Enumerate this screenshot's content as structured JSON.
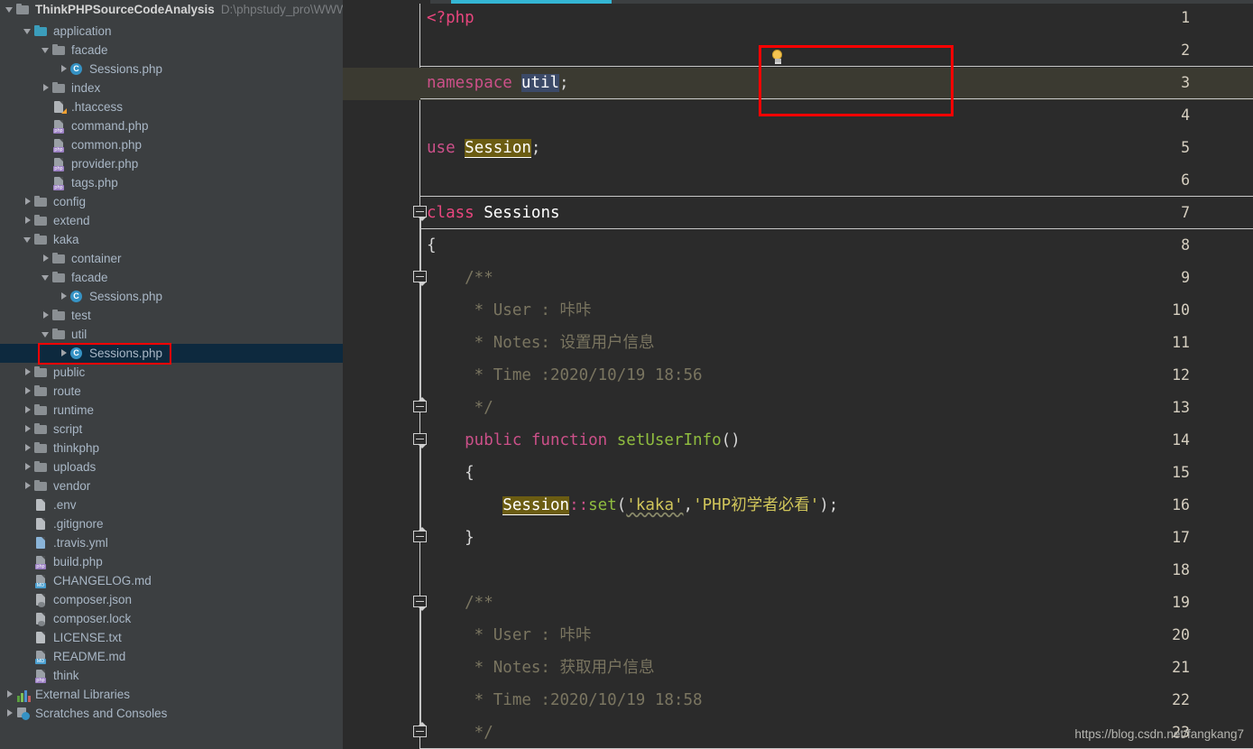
{
  "window": {
    "theme": "darcula",
    "accent_color": "#34b6d4",
    "annotation_color": "#ff0000",
    "selection_row_color": "#0d293e",
    "current_line_color": "#3b3a31"
  },
  "project_tree": {
    "root": {
      "label": "ThinkPHPSourceCodeAnalysis",
      "path": "D:\\phpstudy_pro\\WWW\\Th",
      "icon": "folder-icon",
      "expanded": true
    },
    "items": [
      {
        "label": "application",
        "icon": "folder-icon-blue",
        "indent": 1,
        "arrow": "open",
        "type": "folder"
      },
      {
        "label": "facade",
        "icon": "folder-icon",
        "indent": 2,
        "arrow": "open",
        "type": "folder"
      },
      {
        "label": "Sessions.php",
        "icon": "php-class-icon",
        "indent": 3,
        "arrow": "closed",
        "type": "class"
      },
      {
        "label": "index",
        "icon": "folder-icon",
        "indent": 2,
        "arrow": "closed",
        "type": "folder"
      },
      {
        "label": ".htaccess",
        "icon": "htaccess-file-icon",
        "indent": 2,
        "arrow": "none",
        "type": "file"
      },
      {
        "label": "command.php",
        "icon": "php-file-icon",
        "indent": 2,
        "arrow": "none",
        "type": "file"
      },
      {
        "label": "common.php",
        "icon": "php-file-icon",
        "indent": 2,
        "arrow": "none",
        "type": "file"
      },
      {
        "label": "provider.php",
        "icon": "php-file-icon",
        "indent": 2,
        "arrow": "none",
        "type": "file"
      },
      {
        "label": "tags.php",
        "icon": "php-file-icon",
        "indent": 2,
        "arrow": "none",
        "type": "file"
      },
      {
        "label": "config",
        "icon": "folder-icon",
        "indent": 1,
        "arrow": "closed",
        "type": "folder"
      },
      {
        "label": "extend",
        "icon": "folder-icon",
        "indent": 1,
        "arrow": "closed",
        "type": "folder"
      },
      {
        "label": "kaka",
        "icon": "folder-icon",
        "indent": 1,
        "arrow": "open",
        "type": "folder"
      },
      {
        "label": "container",
        "icon": "folder-icon",
        "indent": 2,
        "arrow": "closed",
        "type": "folder"
      },
      {
        "label": "facade",
        "icon": "folder-icon",
        "indent": 2,
        "arrow": "open",
        "type": "folder"
      },
      {
        "label": "Sessions.php",
        "icon": "php-class-icon",
        "indent": 3,
        "arrow": "closed",
        "type": "class"
      },
      {
        "label": "test",
        "icon": "folder-icon",
        "indent": 2,
        "arrow": "closed",
        "type": "folder"
      },
      {
        "label": "util",
        "icon": "folder-icon",
        "indent": 2,
        "arrow": "open",
        "type": "folder"
      },
      {
        "label": "Sessions.php",
        "icon": "php-class-icon",
        "indent": 3,
        "arrow": "closed",
        "type": "class",
        "selected": true,
        "annotated": true
      },
      {
        "label": "public",
        "icon": "folder-icon",
        "indent": 1,
        "arrow": "closed",
        "type": "folder"
      },
      {
        "label": "route",
        "icon": "folder-icon",
        "indent": 1,
        "arrow": "closed",
        "type": "folder"
      },
      {
        "label": "runtime",
        "icon": "folder-icon",
        "indent": 1,
        "arrow": "closed",
        "type": "folder"
      },
      {
        "label": "script",
        "icon": "folder-icon",
        "indent": 1,
        "arrow": "closed",
        "type": "folder"
      },
      {
        "label": "thinkphp",
        "icon": "folder-icon",
        "indent": 1,
        "arrow": "closed",
        "type": "folder"
      },
      {
        "label": "uploads",
        "icon": "folder-icon",
        "indent": 1,
        "arrow": "closed",
        "type": "folder"
      },
      {
        "label": "vendor",
        "icon": "folder-icon",
        "indent": 1,
        "arrow": "closed",
        "type": "folder"
      },
      {
        "label": ".env",
        "icon": "text-file-icon",
        "indent": 1,
        "arrow": "none",
        "type": "file"
      },
      {
        "label": ".gitignore",
        "icon": "text-file-icon",
        "indent": 1,
        "arrow": "none",
        "type": "file"
      },
      {
        "label": ".travis.yml",
        "icon": "yaml-file-icon",
        "indent": 1,
        "arrow": "none",
        "type": "file"
      },
      {
        "label": "build.php",
        "icon": "php-file-icon",
        "indent": 1,
        "arrow": "none",
        "type": "file"
      },
      {
        "label": "CHANGELOG.md",
        "icon": "markdown-file-icon",
        "indent": 1,
        "arrow": "none",
        "type": "file"
      },
      {
        "label": "composer.json",
        "icon": "composer-file-icon",
        "indent": 1,
        "arrow": "none",
        "type": "file"
      },
      {
        "label": "composer.lock",
        "icon": "composer-file-icon",
        "indent": 1,
        "arrow": "none",
        "type": "file"
      },
      {
        "label": "LICENSE.txt",
        "icon": "text-file-icon",
        "indent": 1,
        "arrow": "none",
        "type": "file"
      },
      {
        "label": "README.md",
        "icon": "markdown-file-icon",
        "indent": 1,
        "arrow": "none",
        "type": "file"
      },
      {
        "label": "think",
        "icon": "php-file-icon",
        "indent": 1,
        "arrow": "none",
        "type": "file"
      },
      {
        "label": "External Libraries",
        "icon": "libraries-icon",
        "indent": 0,
        "arrow": "closed",
        "type": "node"
      },
      {
        "label": "Scratches and Consoles",
        "icon": "scratches-icon",
        "indent": 0,
        "arrow": "closed",
        "type": "node"
      }
    ]
  },
  "editor": {
    "file_type": "php",
    "lines": [
      {
        "n": "1",
        "text": "<?php"
      },
      {
        "n": "2",
        "text": ""
      },
      {
        "n": "3",
        "text": "namespace util;",
        "current": true,
        "annotated": true
      },
      {
        "n": "4",
        "text": ""
      },
      {
        "n": "5",
        "text": "use Session;"
      },
      {
        "n": "6",
        "text": ""
      },
      {
        "n": "7",
        "text": "class Sessions"
      },
      {
        "n": "8",
        "text": "{"
      },
      {
        "n": "9",
        "text": "    /**"
      },
      {
        "n": "10",
        "text": "     * User : 咔咔"
      },
      {
        "n": "11",
        "text": "     * Notes: 设置用户信息"
      },
      {
        "n": "12",
        "text": "     * Time :2020/10/19 18:56"
      },
      {
        "n": "13",
        "text": "     */"
      },
      {
        "n": "14",
        "text": "    public function setUserInfo()"
      },
      {
        "n": "15",
        "text": "    {"
      },
      {
        "n": "16",
        "text": "        Session::set('kaka','PHP初学者必看');"
      },
      {
        "n": "17",
        "text": "    }"
      },
      {
        "n": "18",
        "text": ""
      },
      {
        "n": "19",
        "text": "    /**"
      },
      {
        "n": "20",
        "text": "     * User : 咔咔"
      },
      {
        "n": "21",
        "text": "     * Notes: 获取用户信息"
      },
      {
        "n": "22",
        "text": "     * Time :2020/10/19 18:58"
      },
      {
        "n": "23",
        "text": "     */"
      }
    ],
    "tokens": {
      "php_open": "<?php",
      "kw_namespace": "namespace",
      "ns_value": "util",
      "kw_use": "use",
      "use_value": "Session",
      "kw_class": "class",
      "class_name": "Sessions",
      "brace_open": "{",
      "brace_close": "}",
      "doc_open": "/**",
      "doc_close": "*/",
      "doc_user_label": "* User :",
      "doc_user_value": "咔咔",
      "doc_notes_label": "* Notes:",
      "doc_notes_set": "设置用户信息",
      "doc_notes_get": "获取用户信息",
      "doc_time_label": "* Time :",
      "doc_time_set": "2020/10/19 18:56",
      "doc_time_get": "2020/10/19 18:58",
      "kw_public": "public",
      "kw_function": "function",
      "method_name": "setUserInfo",
      "parens": "()",
      "call_class": "Session",
      "scope_op": "::",
      "call_method": "set",
      "arg1": "'kaka'",
      "arg_sep": ",",
      "arg2": "'PHP初学者必看'",
      "stmt_end": ");",
      "semicolon": ";"
    },
    "intention_icon": "lightbulb-icon"
  },
  "watermark": "https://blog.csdn.net/fangkang7"
}
